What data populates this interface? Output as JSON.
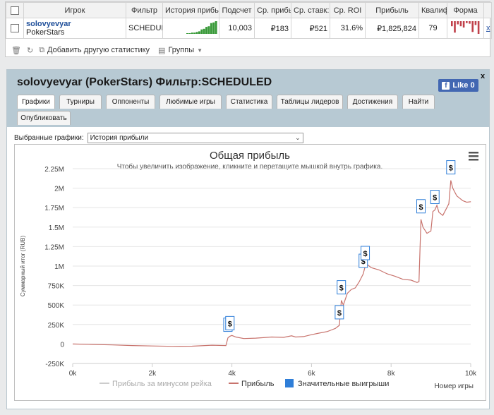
{
  "table": {
    "headers": [
      "Игрок",
      "Фильтр",
      "История прибы",
      "Подсчет",
      "Ср. прибы",
      "Ср. ставк:",
      "Ср. ROI",
      "Прибыль",
      "Квалиф",
      "Форма"
    ],
    "row": {
      "player": "solovyevyar",
      "site": "PokerStars",
      "filter": "SCHEDUL",
      "count": "10,003",
      "avg_profit": "₽183",
      "avg_stake": "₽521",
      "avg_roi": "31.6%",
      "profit": "₽1,825,824",
      "ability": "79",
      "close": "x"
    },
    "sparkline": [
      0.05,
      0.05,
      0.1,
      0.1,
      0.15,
      0.2,
      0.35,
      0.4,
      0.55,
      0.6,
      0.85,
      0.9,
      1.0
    ],
    "form_bars": [
      0.4,
      0.9,
      0.25,
      0.4,
      0.5,
      0.15,
      0.2,
      0.85,
      0.3,
      1.0
    ]
  },
  "toolbar": {
    "add_stats": "Добавить другую статистику",
    "groups": "Группы"
  },
  "panel": {
    "title": "solovyevyar (PokerStars) Фильтр:SCHEDULED",
    "like_label": "Like 0",
    "close": "x",
    "tabs": [
      "Графики",
      "Турниры",
      "Оппоненты",
      "Любимые игры",
      "Статистика",
      "Таблицы лидеров",
      "Достижения",
      "Найти",
      "Опубликовать"
    ],
    "active_tab": 0,
    "select_label": "Выбранные графики:",
    "select_value": "История прибыли"
  },
  "colors": {
    "profit_line": "#c8736d",
    "rake_line": "#cccccc",
    "big_wins": "#2f7ed8",
    "link": "#1f4f9a",
    "sparkline": "#3a9a3a",
    "form_bar": "#c0404a"
  },
  "chart_data": {
    "type": "line",
    "title": "Общая прибыль",
    "subtitle": "Чтобы увеличить изображение, кликните и перетащите мышкой внутрь графика.",
    "xlabel": "Номер игры",
    "ylabel": "Суммарный итог (RUB)",
    "xlim": [
      0,
      10000
    ],
    "ylim": [
      -250000,
      2250000
    ],
    "x_ticks": [
      0,
      2000,
      4000,
      6000,
      8000,
      10000
    ],
    "x_tick_labels": [
      "0k",
      "2k",
      "4k",
      "6k",
      "8k",
      "10k"
    ],
    "y_ticks": [
      -250000,
      0,
      250000,
      500000,
      750000,
      1000000,
      1250000,
      1500000,
      1750000,
      2000000,
      2250000
    ],
    "y_tick_labels": [
      "-250K",
      "0",
      "250K",
      "500K",
      "750K",
      "1M",
      "1.25M",
      "1.5M",
      "1.75M",
      "2M",
      "2.25M"
    ],
    "grid": true,
    "legend_position": "bottom",
    "legend": [
      "Прибыль за минусом рейка",
      "Прибыль",
      "Значительные выигрыши"
    ],
    "series": [
      {
        "name": "Прибыль",
        "x": [
          0,
          500,
          1000,
          1500,
          2000,
          2500,
          3000,
          3500,
          3850,
          3900,
          3950,
          4000,
          4100,
          4300,
          4600,
          5000,
          5300,
          5500,
          5600,
          5800,
          6000,
          6200,
          6400,
          6500,
          6600,
          6700,
          6750,
          6800,
          6900,
          7000,
          7100,
          7200,
          7300,
          7350,
          7400,
          7450,
          7500,
          7700,
          7900,
          8100,
          8300,
          8500,
          8650,
          8700,
          8750,
          8800,
          8900,
          9000,
          9050,
          9100,
          9150,
          9200,
          9300,
          9400,
          9450,
          9500,
          9550,
          9600,
          9650,
          9700,
          9800,
          9900,
          10003
        ],
        "y": [
          0,
          -5000,
          -12000,
          -20000,
          -25000,
          -30000,
          -28000,
          -15000,
          -20000,
          80000,
          100000,
          110000,
          90000,
          70000,
          75000,
          90000,
          85000,
          105000,
          90000,
          95000,
          120000,
          140000,
          160000,
          180000,
          200000,
          240000,
          560000,
          500000,
          650000,
          700000,
          720000,
          800000,
          900000,
          1000000,
          1020000,
          1000000,
          980000,
          950000,
          900000,
          870000,
          830000,
          820000,
          790000,
          800000,
          1600000,
          1500000,
          1420000,
          1450000,
          1700000,
          1720000,
          1780000,
          1690000,
          1650000,
          1750000,
          1800000,
          2100000,
          2000000,
          1950000,
          1900000,
          1880000,
          1840000,
          1820000,
          1825824
        ]
      }
    ],
    "big_wins_x": [
      3900,
      3950,
      6700,
      6750,
      7300,
      7350,
      8750,
      9100,
      9500
    ]
  }
}
